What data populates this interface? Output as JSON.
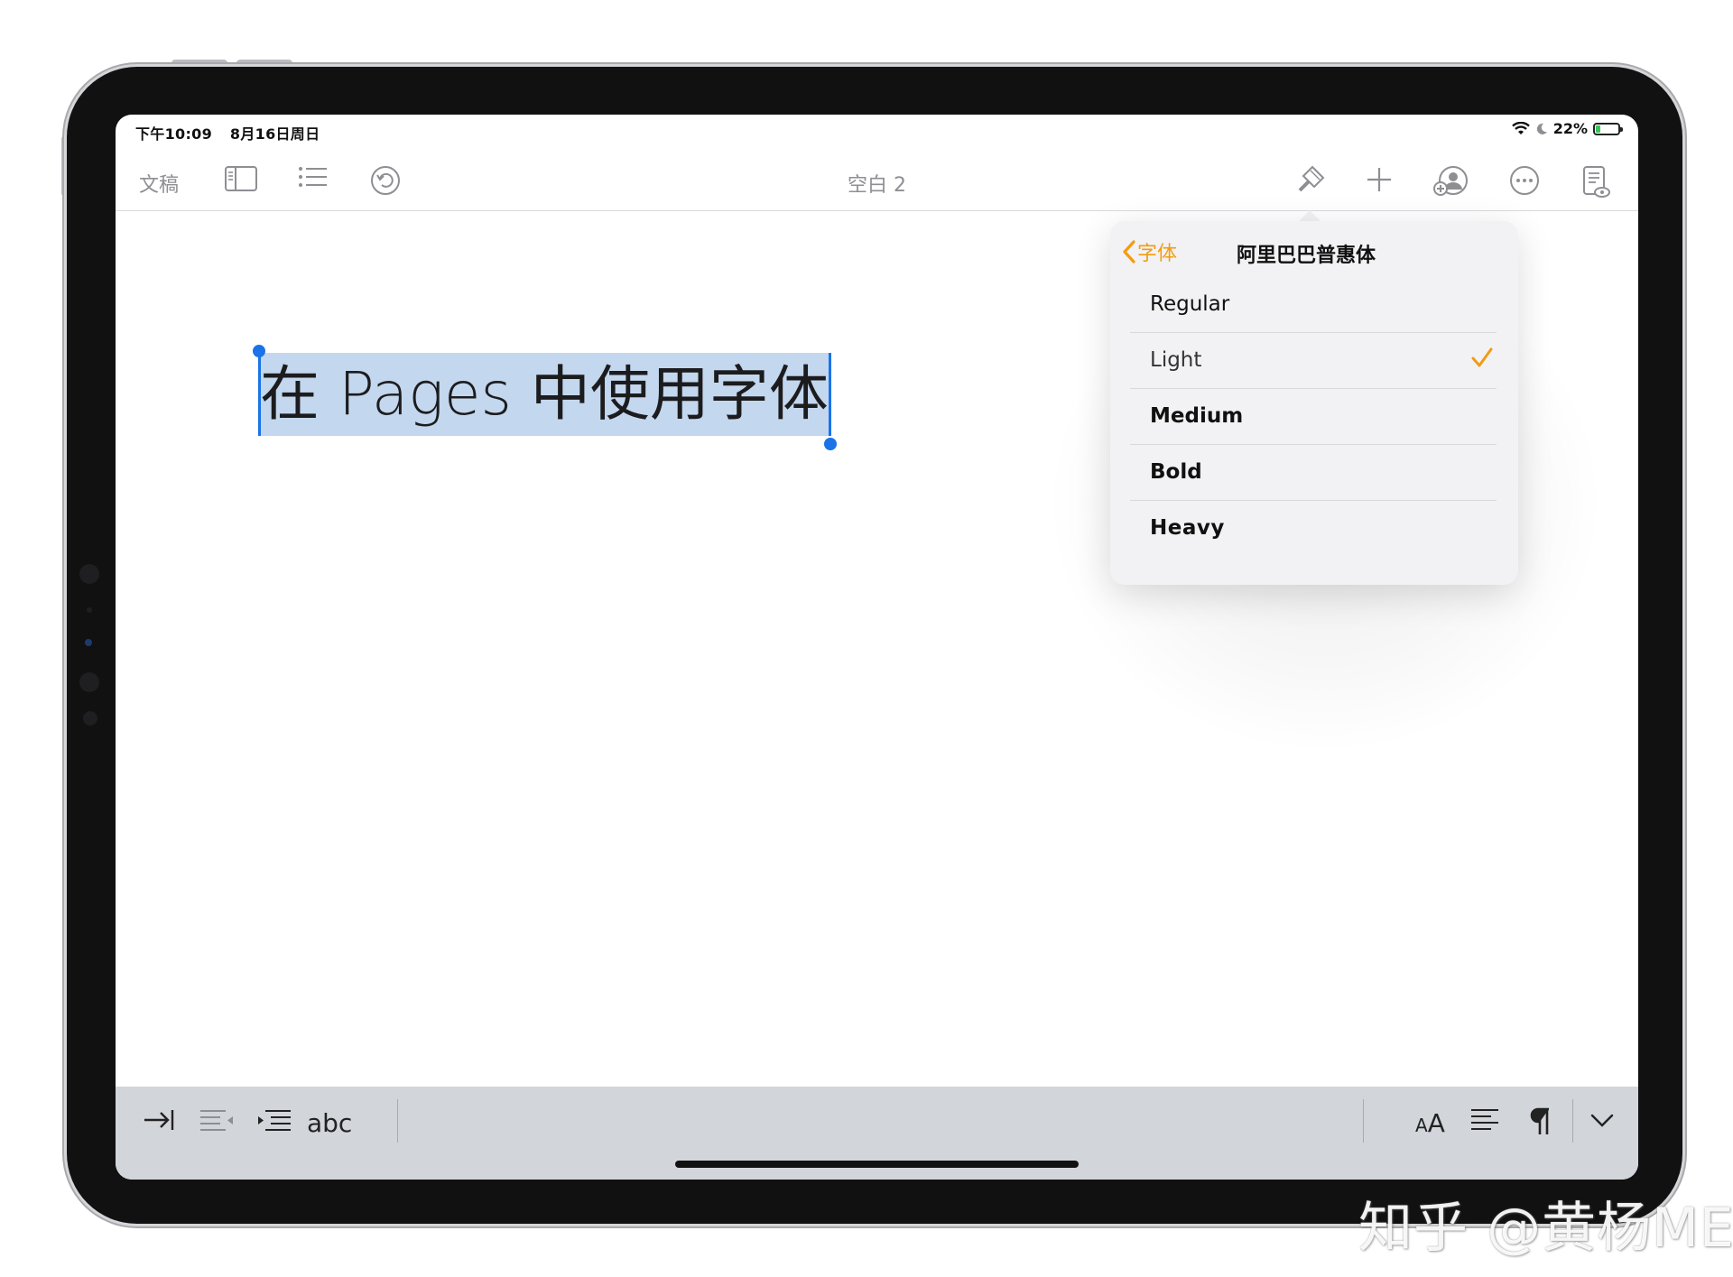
{
  "status_bar": {
    "time": "下午10:09",
    "date": "8月16日周日",
    "battery_percent": "22%",
    "battery_level": 0.22
  },
  "toolbar": {
    "documents_label": "文稿",
    "document_title": "空白 2"
  },
  "document": {
    "selected_text": "在 Pages 中使用字体"
  },
  "font_popover": {
    "back_label": "字体",
    "title": "阿里巴巴普惠体",
    "options": [
      {
        "label": "Regular",
        "selected": false
      },
      {
        "label": "Light",
        "selected": true
      },
      {
        "label": "Medium",
        "selected": false
      },
      {
        "label": "Bold",
        "selected": false
      },
      {
        "label": "Heavy",
        "selected": false
      }
    ]
  },
  "keyboard_bar": {
    "spellcheck_label": "abc",
    "font_size_label": "AA"
  },
  "colors": {
    "accent": "#f39c12",
    "selection": "#c3d7ee",
    "caret": "#1a73e8"
  },
  "watermark": "知乎 @黄杨ME"
}
